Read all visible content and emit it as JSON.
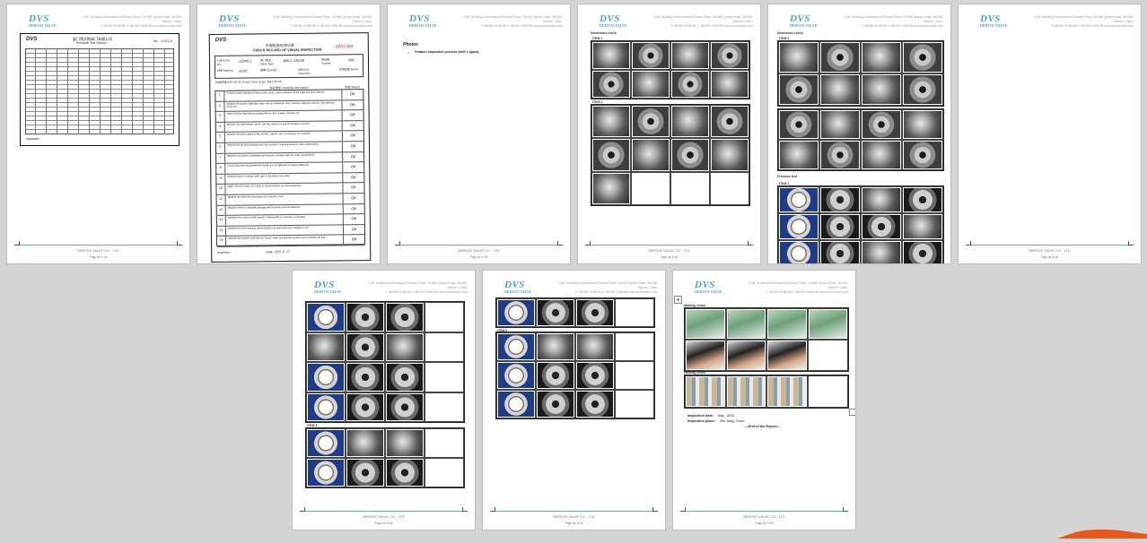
{
  "header": {
    "logo": "DVS",
    "logo_sub": "DERVOS VALVE",
    "address_line1": "1205, Building A International Finance Place, No.568 Qianpu Road, 361008, Xiamen, China.",
    "address_line2": "T:+86 592 5185196    F:+86 592 5185196    www.dervosvalve.com"
  },
  "footer": {
    "text": "DERVOS VALVE CO., LTD",
    "page_label": "Page ## of ##"
  },
  "page1": {
    "title_cn": "厦门德沃斯阀门有限公司",
    "title_en": "Pressure Test Record",
    "no_label": "No.",
    "no_value": "0000116",
    "sign_label": "Inspector:"
  },
  "page2": {
    "title_cn": "外观检验检测记录",
    "title_en": "CHECK RECORD OF VISUAL INSPECTION",
    "no_value": "0002369",
    "pc_label": "订单号 PC NO.",
    "pc_value": "12045-1",
    "type_label": "阀门类型 Valve Type",
    "type_value": "BALL VALVE",
    "supplier_label": "供应商 Supplier",
    "supplier_value": "N/A",
    "material_label": "材质 Material",
    "material_value": "A105",
    "qty_label": "数量 Quantity",
    "full_label": "全检 Full Inspection",
    "result_label": "检验结果 Result",
    "std_label": "检验依据 MSS SP-55 Visual Check as per: MSS SP-55",
    "desc_label": "检验描述 Checking description",
    "remark_label": "判定 Result",
    "items": [
      "Product surface should not have cracks, pores, sand inclusions, shrink holes and other defects.",
      "Whether the product marking is clear such as trademark, size, pressure, material, heat No., flow direction arrow, etc.",
      "Valve must be clean before packing without dust, grease, particles, etc.",
      "Whether the casting flash, sprue, riser are cleaned up and the surface is smooth.",
      "Whether the paint coating is flat, smooth, uniform color, no missing, no scratches.",
      "Whether the dry film thickness and color number of painting meet the order requirements.",
      "Whether the product's nameplate and tag are consistent with the order requirements.",
      "Ensure that valve handwheel and handle are not tightened to prevent falling off.",
      "Whether there is nothing, trash, grits in the valve body cavity.",
      "Make sure the product is in open or closed position per the requirement.",
      "Whether the valve port has dustproof, protective cover.",
      "Whether there is a separate package with document and the fasteners.",
      "Whether the product is well covered, marking with no confusion or sloshing.",
      "Whether the outer packing, check whether the spare parts are complete or not.",
      "Whether the wooden case has iron hoops, make sure that the wooden case is affixed with lugs."
    ],
    "result_mark": "OK",
    "inspector_label": "Inspector:",
    "date_label": "Date: 2022. 6. 27"
  },
  "page3": {
    "heading": "Photos",
    "bullet": "Product inspection process (with 1 agent)"
  },
  "photo_labels": {
    "dimension": "Dimension check",
    "item1": "ITEM 1",
    "item2": "ITEM 2",
    "item3": "ITEM 3",
    "pressure": "Pressure test",
    "marking": "Marking check",
    "packing": "Packing check"
  },
  "page9": {
    "inspection_date_label": "Inspection date:",
    "inspection_date_value": "May , 2023",
    "inspection_place_label": "Inspection place:",
    "inspection_place_value": "Zhe Jiang, China",
    "end_text": "---End of the Report---"
  },
  "colors": {
    "accent": "#4aa3c8",
    "footer_rule": "#59b9a8",
    "viewer_bg": "#d4d4d4",
    "scroll_thumb": "#e8581a"
  }
}
